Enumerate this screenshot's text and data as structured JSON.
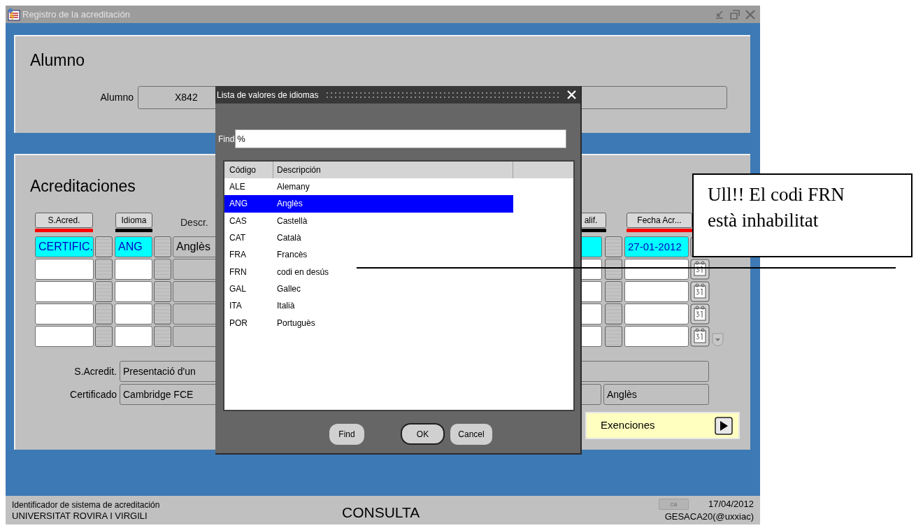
{
  "window": {
    "title": "Registro de la acreditación"
  },
  "alumno": {
    "heading": "Alumno",
    "label": "Alumno",
    "value": "X842"
  },
  "acreditaciones": {
    "heading": "Acreditaciones",
    "left_columns": [
      {
        "kind": "button",
        "label": "S.Acred.",
        "required": true
      },
      {
        "kind": "button",
        "label": "Idioma",
        "required": false
      },
      {
        "kind": "text",
        "label": "Descr."
      }
    ],
    "right_columns": [
      {
        "kind": "button",
        "label": "alif.",
        "required": false
      },
      {
        "kind": "button",
        "label": "Fecha Acr...",
        "required": true
      }
    ],
    "rows": [
      {
        "s_acred": "CERTIFIC.",
        "idioma": "ANG",
        "descr": "Anglès",
        "fecha": "27-01-2012",
        "current": true
      },
      {
        "current": false
      },
      {
        "current": false
      },
      {
        "current": false
      },
      {
        "current": false
      }
    ],
    "s_acredit": {
      "label": "S.Acredit.",
      "value": "Presentació d'un"
    },
    "certificado": {
      "label": "Certificado",
      "value": "Cambridge FCE",
      "idioma": "Anglès"
    },
    "exenciones": "Exenciones"
  },
  "dialog": {
    "title": "Lista de valores de idiomas",
    "find_label": "Find",
    "find_value": "%",
    "columns": [
      "Código",
      "Descripción"
    ],
    "rows": [
      {
        "code": "ALE",
        "description": "Alemany",
        "selected": false
      },
      {
        "code": "ANG",
        "description": "Anglès",
        "selected": true
      },
      {
        "code": "CAS",
        "description": "Castellà",
        "selected": false
      },
      {
        "code": "CAT",
        "description": "Català",
        "selected": false
      },
      {
        "code": "FRA",
        "description": "Francès",
        "selected": false
      },
      {
        "code": "FRN",
        "description": "codi en desús",
        "selected": false
      },
      {
        "code": "GAL",
        "description": "Gallec",
        "selected": false
      },
      {
        "code": "ITA",
        "description": "Italià",
        "selected": false
      },
      {
        "code": "POR",
        "description": "Portuguès",
        "selected": false
      }
    ],
    "buttons": [
      "Find",
      "OK",
      "Cancel"
    ]
  },
  "status_bar": {
    "message": "Identificador de sistema de acreditación",
    "organization": "UNIVERSITAT ROVIRA I VIRGILI",
    "mode": "CONSULTA",
    "language": "ca",
    "date": "17/04/2012",
    "user": "GESACA20(@uxxiac)"
  },
  "annotation": {
    "text": "Ull!! El codi FRN està inhabilitat"
  }
}
